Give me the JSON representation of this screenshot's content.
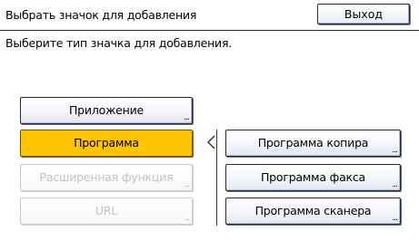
{
  "header": {
    "title": "Выбрать значок для добавления",
    "exit_label": "Выход"
  },
  "instruction": "Выберите тип значка для добавления.",
  "left_buttons": [
    {
      "label": "Приложение",
      "state": "normal"
    },
    {
      "label": "Программа",
      "state": "selected"
    },
    {
      "label": "Расширенная функция",
      "state": "disabled"
    },
    {
      "label": "URL",
      "state": "disabled"
    }
  ],
  "right_buttons": [
    {
      "label": "Программа копира"
    },
    {
      "label": "Программа факса"
    },
    {
      "label": "Программа сканера"
    }
  ],
  "ellipsis": "...",
  "colors": {
    "selected": "#ffc300",
    "border": "#2a2a2a",
    "disabled_text": "#c4c4c4"
  },
  "icons": {
    "bracket": "left-angle-bracket-icon"
  }
}
